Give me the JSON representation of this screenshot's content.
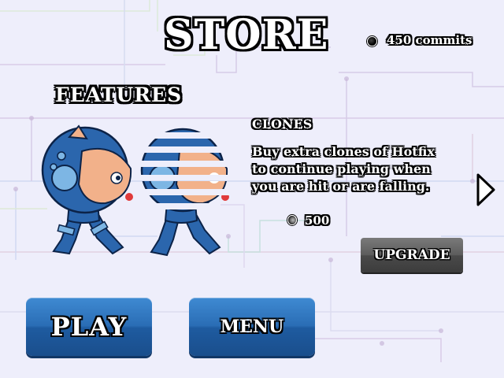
{
  "store": {
    "title": "STORE",
    "commits": "450 commits"
  },
  "features_label": "FEATURES",
  "feature": {
    "title": "CLONES",
    "description_lines": [
      "Buy extra clones of Hotfix",
      "to continue playing when",
      "you are hit or are falling."
    ],
    "price": "500",
    "upgrade_label": "UPGRADE"
  },
  "buttons": {
    "play": "PLAY",
    "menu": "MENU"
  },
  "icons": {
    "currency": "coin-icon",
    "next": "chevron-right-icon",
    "character": "hotfix-character",
    "clone": "hotfix-clone"
  },
  "colors": {
    "background": "#eeeefb",
    "button_blue": "#2a6db5",
    "upgrade_gray": "#5c5c5c",
    "character_blue": "#2b66ad",
    "character_skin": "#f2b18a"
  }
}
